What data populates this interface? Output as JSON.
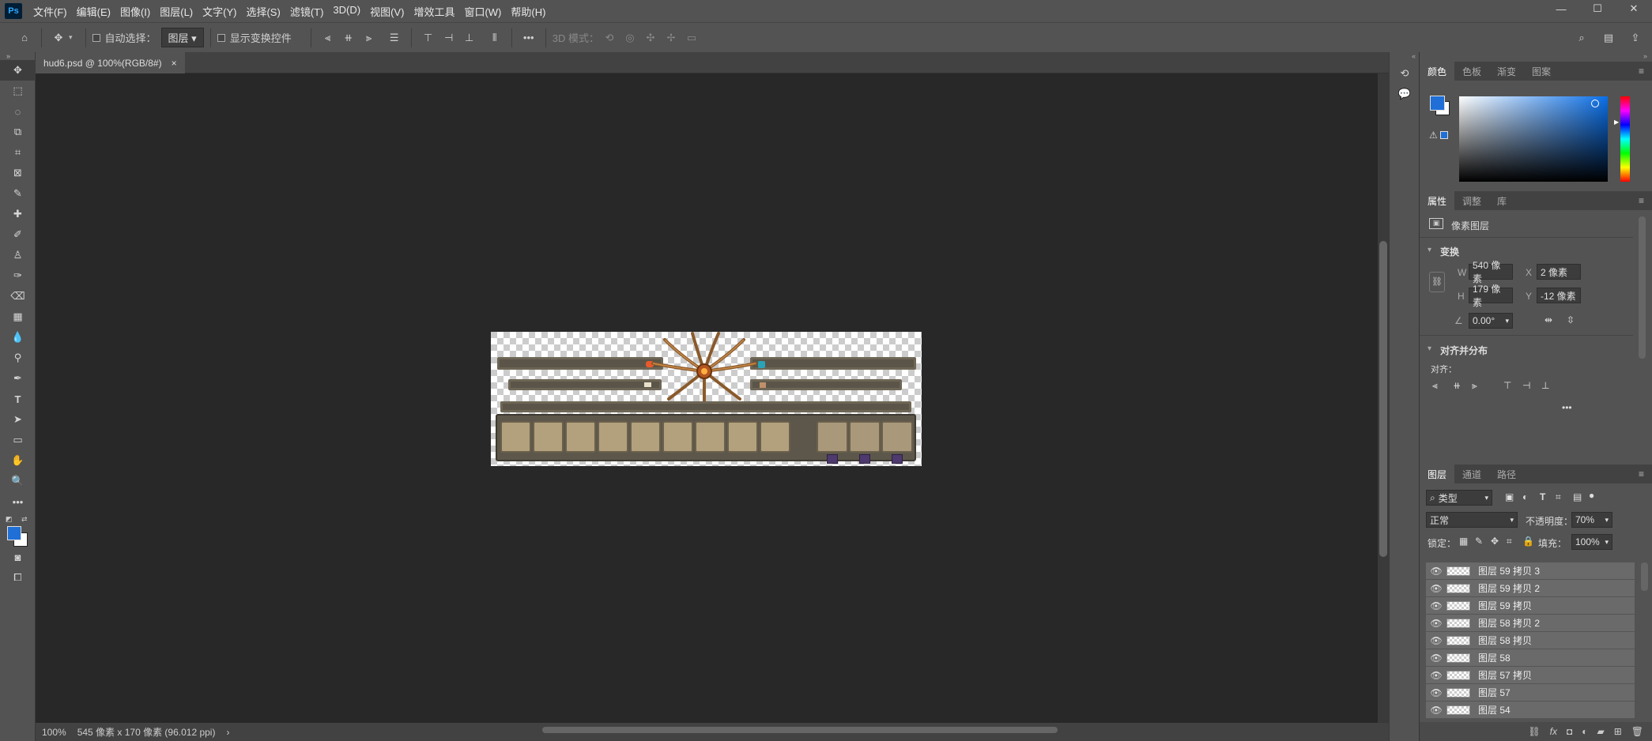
{
  "app": {
    "logo": "Ps"
  },
  "menu": [
    "文件(F)",
    "编辑(E)",
    "图像(I)",
    "图层(L)",
    "文字(Y)",
    "选择(S)",
    "滤镜(T)",
    "3D(D)",
    "视图(V)",
    "增效工具",
    "窗口(W)",
    "帮助(H)"
  ],
  "window_controls": {
    "minimize": "—",
    "maximize": "☐",
    "close": "✕"
  },
  "options": {
    "auto_select_label": "自动选择：",
    "auto_select_value": "图层",
    "show_transform_label": "显示变换控件",
    "mode_3d_label": "3D 模式："
  },
  "document": {
    "tab_title": "hud6.psd @ 100%(RGB/8#)",
    "close": "×",
    "zoom": "100%",
    "info": "545 像素 x 170 像素 (96.012 ppi)"
  },
  "color_panel": {
    "tabs": [
      "颜色",
      "色板",
      "渐变",
      "图案"
    ],
    "active": "颜色",
    "fg_color": "#1f6fd6",
    "bg_color": "#ffffff"
  },
  "properties_panel": {
    "tabs": [
      "属性",
      "调整",
      "库"
    ],
    "active": "属性",
    "layer_type": "像素图层",
    "transform_title": "变换",
    "w_label": "W",
    "w_value": "540 像素",
    "h_label": "H",
    "h_value": "179 像素",
    "x_label": "X",
    "x_value": "2 像素",
    "y_label": "Y",
    "y_value": "-12 像素",
    "angle_value": "0.00°",
    "align_title": "对齐并分布",
    "align_label": "对齐：",
    "more": "•••"
  },
  "layers_panel": {
    "tabs": [
      "图层",
      "通道",
      "路径"
    ],
    "active": "图层",
    "filter_value": "类型",
    "blend_mode": "正常",
    "opacity_label": "不透明度：",
    "opacity_value": "70%",
    "lock_label": "锁定：",
    "fill_label": "填充：",
    "fill_value": "100%",
    "layers": [
      "图层 59 拷贝 3",
      "图层 59 拷贝 2",
      "图层 59 拷贝",
      "图层 58 拷贝 2",
      "图层 58 拷贝",
      "图层 58",
      "图层 57 拷贝",
      "图层 57",
      "图层 54"
    ]
  }
}
